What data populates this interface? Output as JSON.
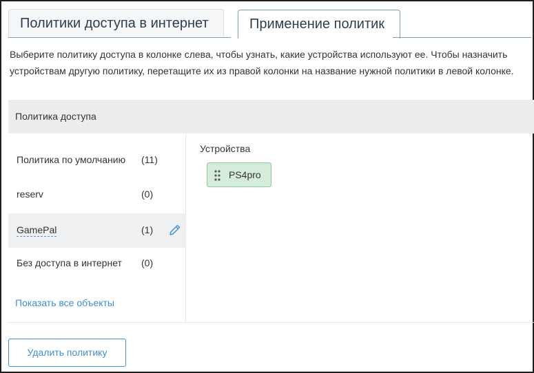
{
  "tabs": [
    {
      "label": "Политики доступа в интернет",
      "active": false
    },
    {
      "label": "Применение политик",
      "active": true
    }
  ],
  "description": "Выберите политику доступа в колонке слева, чтобы узнать, какие устройства используют ее. Чтобы назначить устройствам другую политику, перетащите их из правой колонки на название нужной политики в левой колонке.",
  "table": {
    "header": "Политика доступа",
    "policies": [
      {
        "name": "Политика по умолчанию",
        "count": "(11)",
        "selected": false
      },
      {
        "name": "reserv",
        "count": "(0)",
        "selected": false
      },
      {
        "name": "GamePal",
        "count": "(1)",
        "selected": true
      },
      {
        "name": "Без доступа в интернет",
        "count": "(0)",
        "selected": false
      }
    ],
    "show_all": "Показать все объекты"
  },
  "devices": {
    "label": "Устройства",
    "items": [
      {
        "name": "PS4pro"
      }
    ]
  },
  "actions": {
    "delete_label": "Удалить политику"
  },
  "colors": {
    "accent": "#3f8fd2",
    "device_chip_bg": "#d6ecdb",
    "selected_row_bg": "#eef0f2",
    "header_bg": "#ebedef"
  },
  "icons": {
    "edit": "pencil-icon",
    "drag": "drag-handle-icon"
  }
}
